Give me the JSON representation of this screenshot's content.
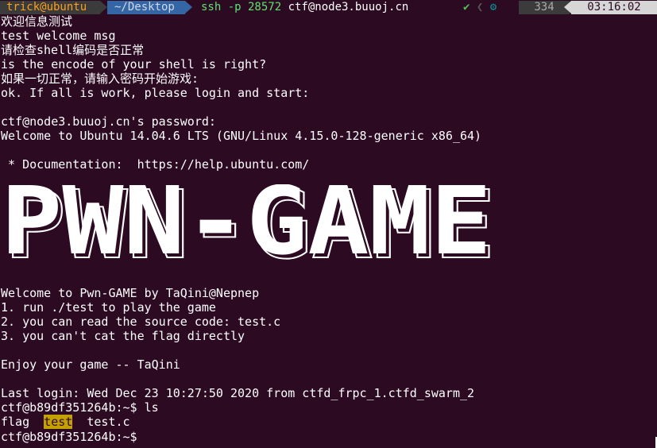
{
  "prompt": {
    "user_host": "trick@ubuntu",
    "directory": "~/Desktop",
    "command_prefix": "ssh -p 28572 ",
    "command_host": "ctf@node3.buuoj.cn",
    "status_check": "✔",
    "status_gear": "⚙",
    "history_count": "334",
    "clock": "03:16:02"
  },
  "lines": {
    "l1": "欢迎信息测试",
    "l2": "test welcome msg",
    "l3": "请检查shell编码是否正常",
    "l4": "is the encode of your shell is right?",
    "l5": "如果一切正常，请输入密码开始游戏:",
    "l6": "ok. If all is work, please login and start:",
    "l7": "ctf@node3.buuoj.cn's password:",
    "l8": "Welcome to Ubuntu 14.04.6 LTS (GNU/Linux 4.15.0-128-generic x86_64)",
    "l9": " * Documentation:  https://help.ubuntu.com/",
    "l10": "Welcome to Pwn-GAME by TaQini@Nepnep",
    "l11": "1. run ./test to play the game",
    "l12": "2. you can read the source code: test.c",
    "l13": "3. you can't cat the flag directly",
    "l14": "Enjoy your game -- TaQini",
    "l15": "Last login: Wed Dec 23 10:27:50 2020 from ctfd_frpc_1.ctfd_swarm_2",
    "l16": "ctf@b89df351264b:~$ ls",
    "ls_flag": "flag",
    "ls_test": "test",
    "ls_testc": "test.c",
    "l18": "ctf@b89df351264b:~$"
  },
  "banner": {
    "text": "PWN-GAME"
  },
  "colors": {
    "background": "#2c0a22",
    "highlight": "#c4a000",
    "command": "#5ee36f"
  }
}
